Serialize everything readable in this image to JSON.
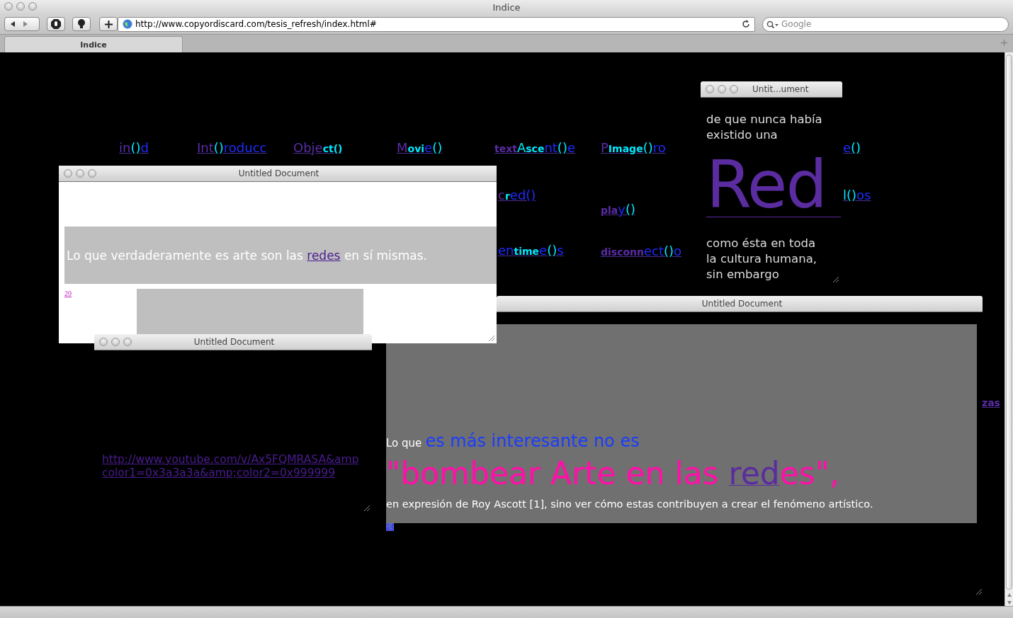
{
  "window": {
    "title": "Indice"
  },
  "toolbar": {
    "url": "http://www.copyordiscard.com/tesis_refresh/index.html#",
    "search": {
      "placeholder": "Google"
    }
  },
  "tabs": [
    {
      "label": "Indice",
      "selected": true
    }
  ],
  "fragments": [
    {
      "parts": [
        {
          "text": "in",
          "color": "#5b2ca8",
          "small": false
        },
        {
          "text": "()",
          "color": "#00e8ff",
          "small": false
        },
        {
          "text": "d",
          "color": "#1e2cff",
          "small": false
        }
      ]
    },
    {
      "parts": [
        {
          "text": "Int",
          "color": "#5b2ca8",
          "small": false
        },
        {
          "text": "()",
          "color": "#00e8ff",
          "small": false
        },
        {
          "text": "roducc",
          "color": "#1e2cff",
          "small": false
        }
      ]
    },
    {
      "parts": [
        {
          "text": "Obje",
          "color": "#5b2ca8",
          "small": false
        },
        {
          "text": "ct()",
          "color": "#00e8ff",
          "small": true
        }
      ]
    },
    {
      "parts": [
        {
          "text": "M",
          "color": "#5b2ca8",
          "small": false
        },
        {
          "text": "ovi",
          "color": "#00e8ff",
          "small": true
        },
        {
          "text": "e",
          "color": "#1e2cff",
          "small": false
        },
        {
          "text": "()",
          "color": "#00e8ff",
          "small": false
        }
      ]
    },
    {
      "parts": [
        {
          "text": "text",
          "color": "#5b2ca8",
          "small": true
        },
        {
          "text": "A",
          "color": "#00e8ff",
          "small": false
        },
        {
          "text": "sce",
          "color": "#00e8ff",
          "small": true
        },
        {
          "text": "nt",
          "color": "#1e2cff",
          "small": false
        },
        {
          "text": "()",
          "color": "#00e8ff",
          "small": false
        },
        {
          "text": "e",
          "color": "#1e2cff",
          "small": false
        }
      ]
    },
    {
      "parts": [
        {
          "text": "P",
          "color": "#5b2ca8",
          "small": false
        },
        {
          "text": "Image",
          "color": "#00e8ff",
          "small": true
        },
        {
          "text": "()",
          "color": "#00e8ff",
          "small": false
        },
        {
          "text": "ro",
          "color": "#1e2cff",
          "small": false
        }
      ]
    },
    {
      "parts": [
        {
          "text": "e",
          "color": "#1e2cff",
          "small": false
        },
        {
          "text": "()",
          "color": "#00e8ff",
          "small": false
        }
      ]
    },
    {
      "parts": [
        {
          "text": "c",
          "color": "#5b2ca8",
          "small": false
        },
        {
          "text": "r",
          "color": "#00e8ff",
          "small": true
        },
        {
          "text": "ed()",
          "color": "#1e2cff",
          "small": false
        }
      ]
    },
    {
      "parts": [
        {
          "text": "l()",
          "color": "#00e8ff",
          "small": false
        },
        {
          "text": "os",
          "color": "#1e2cff",
          "small": false
        }
      ]
    },
    {
      "parts": [
        {
          "text": "pla",
          "color": "#5b2ca8",
          "small": true
        },
        {
          "text": "y",
          "color": "#1e2cff",
          "small": false
        },
        {
          "text": "()",
          "color": "#00e8ff",
          "small": false
        }
      ]
    },
    {
      "parts": [
        {
          "text": "en",
          "color": "#1e2cff",
          "small": false
        },
        {
          "text": "time",
          "color": "#00e8ff",
          "small": true
        },
        {
          "text": "e",
          "color": "#1e2cff",
          "small": false
        },
        {
          "text": "()",
          "color": "#00e8ff",
          "small": false
        },
        {
          "text": "s",
          "color": "#1e2cff",
          "small": false
        }
      ]
    },
    {
      "parts": [
        {
          "text": "disconn",
          "color": "#5b2ca8",
          "small": true
        },
        {
          "text": "ect",
          "color": "#1e2cff",
          "small": false
        },
        {
          "text": "()",
          "color": "#00e8ff",
          "small": false
        },
        {
          "text": "o",
          "color": "#1e2cff",
          "small": false
        }
      ]
    },
    {
      "parts": [
        {
          "text": "zas",
          "color": "#5b2ca8",
          "small": true
        }
      ]
    }
  ],
  "red_window": {
    "title": "Untit...ument",
    "text_before": "de que nunca había existido una",
    "big_word": "Red",
    "text_after": "como ésta en toda la cultura humana, sin embargo"
  },
  "main_window": {
    "title": "Untitled Document",
    "sentence_start": "Lo que verdaderamente es arte son las",
    "link": "redes",
    "sentence_end": "en sí mismas.",
    "page_link": "20"
  },
  "video_window": {
    "title": "Untitled Document",
    "link_lines": [
      "http://www.youtube.com/v/Ax5FQMRASA&amp",
      "color1=0x3a3a3a&amp;color2=0x999999"
    ]
  },
  "quote_window": {
    "title": "Untitled Document",
    "lead": "Lo que",
    "lead_highlight": "es más interesante no es",
    "quote_start": "\"bombear Arte en las",
    "quote_link": "red",
    "quote_end": "es\",",
    "closing": "en expresión de Roy Ascott [1], sino ver cómo estas contribuyen a crear el fenómeno artístico.",
    "page_link": "24"
  }
}
